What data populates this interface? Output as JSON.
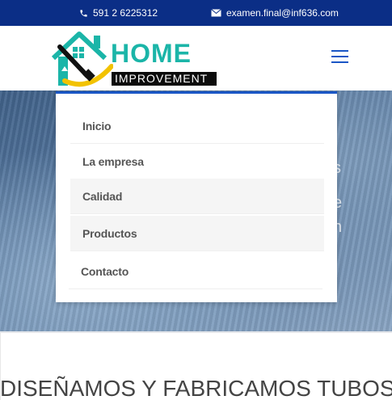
{
  "topbar": {
    "phone": "591 2 6225312",
    "email": "examen.final@inf636.com",
    "phone_icon": "phone-icon",
    "email_icon": "envelope-icon"
  },
  "logo": {
    "word1": "HOME",
    "word2": "IMPROVEMENT"
  },
  "menu": {
    "items": [
      {
        "label": "Inicio"
      },
      {
        "label": "La empresa"
      },
      {
        "label": "Calidad"
      },
      {
        "label": "Productos"
      },
      {
        "label": "Contacto"
      }
    ]
  },
  "hero": {
    "ghost_fragments": [
      "s",
      "e",
      "n"
    ]
  },
  "page": {
    "heading": "DISEÑAMOS Y FABRICAMOS TUBOS"
  },
  "colors": {
    "topbar_bg": "#0b2e86",
    "accent": "#1a56c5",
    "logo_teal": "#1bb5a8",
    "logo_yellow": "#f2c200",
    "menu_text": "#555555"
  }
}
